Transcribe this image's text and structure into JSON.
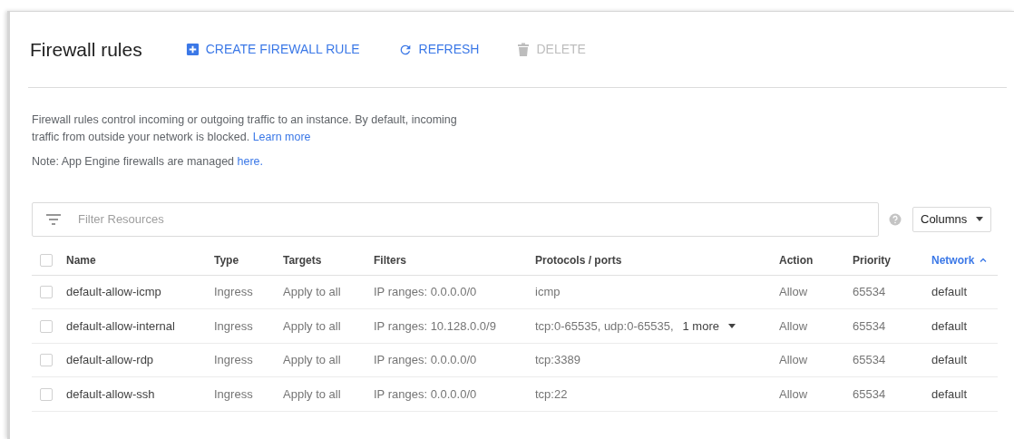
{
  "header": {
    "title": "Firewall rules",
    "actions": [
      {
        "label": "CREATE FIREWALL RULE",
        "kind": "create",
        "disabled": false
      },
      {
        "label": "REFRESH",
        "kind": "refresh",
        "disabled": false
      },
      {
        "label": "DELETE",
        "kind": "delete",
        "disabled": true
      }
    ]
  },
  "description": {
    "text": "Firewall rules control incoming or outgoing traffic to an instance. By default, incoming traffic from outside your network is blocked.",
    "link": "Learn more"
  },
  "note": {
    "text": "Note: App Engine firewalls are managed",
    "link": "here."
  },
  "filter": {
    "placeholder": "Filter Resources"
  },
  "columns_button": {
    "label": "Columns"
  },
  "table": {
    "select_all": {
      "checked": false
    },
    "columns": [
      {
        "label": "Name",
        "sorted": false
      },
      {
        "label": "Type",
        "sorted": false
      },
      {
        "label": "Targets",
        "sorted": false
      },
      {
        "label": "Filters",
        "sorted": false
      },
      {
        "label": "Protocols / ports",
        "sorted": false
      },
      {
        "label": "Action",
        "sorted": false
      },
      {
        "label": "Priority",
        "sorted": false
      },
      {
        "label": "Network",
        "sorted": true
      }
    ],
    "rows": [
      {
        "checked": false,
        "name": "default-allow-icmp",
        "type": "Ingress",
        "targets": "Apply to all",
        "filters": "IP ranges: 0.0.0.0/0",
        "protocols": "icmp",
        "action": "Allow",
        "priority": "65534",
        "network": "default"
      },
      {
        "checked": false,
        "name": "default-allow-internal",
        "type": "Ingress",
        "targets": "Apply to all",
        "filters": "IP ranges: 10.128.0.0/9",
        "protocols": "tcp:0-65535, udp:0-65535,",
        "more": "1 more",
        "action": "Allow",
        "priority": "65534",
        "network": "default"
      },
      {
        "checked": false,
        "name": "default-allow-rdp",
        "type": "Ingress",
        "targets": "Apply to all",
        "filters": "IP ranges: 0.0.0.0/0",
        "protocols": "tcp:3389",
        "action": "Allow",
        "priority": "65534",
        "network": "default"
      },
      {
        "checked": false,
        "name": "default-allow-ssh",
        "type": "Ingress",
        "targets": "Apply to all",
        "filters": "IP ranges: 0.0.0.0/0",
        "protocols": "tcp:22",
        "action": "Allow",
        "priority": "65534",
        "network": "default"
      }
    ]
  }
}
